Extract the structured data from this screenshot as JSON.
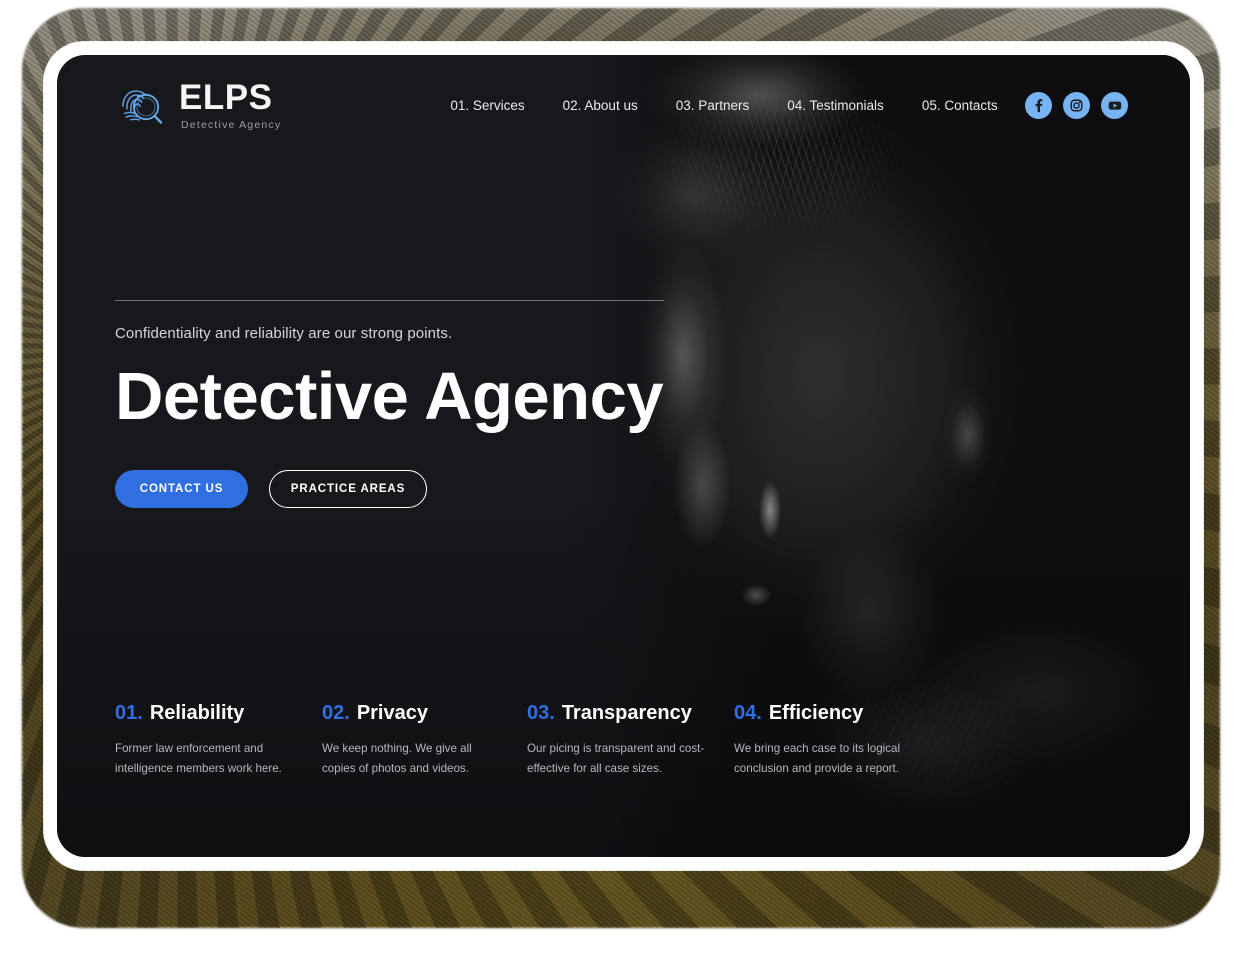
{
  "brand": {
    "name": "ELPS",
    "tagline": "Detective Agency",
    "icon": "fingerprint-magnifier-icon"
  },
  "nav": {
    "items": [
      {
        "label": "01. Services"
      },
      {
        "label": "02. About us"
      },
      {
        "label": "03. Partners"
      },
      {
        "label": "04. Testimonials"
      },
      {
        "label": "05. Contacts"
      }
    ]
  },
  "socials": [
    {
      "name": "facebook-icon",
      "label": "Facebook"
    },
    {
      "name": "instagram-icon",
      "label": "Instagram"
    },
    {
      "name": "youtube-icon",
      "label": "YouTube"
    }
  ],
  "hero": {
    "tagline": "Confidentiality and reliability are our strong points.",
    "title": "Detective Agency",
    "primary_button": "CONTACT US",
    "secondary_button": "PRACTICE AREAS"
  },
  "features": [
    {
      "num": "01.",
      "title": "Reliability",
      "desc": "Former law enforcement and intelligence members work here."
    },
    {
      "num": "02.",
      "title": "Privacy",
      "desc": "We keep nothing. We give all copies of photos and videos."
    },
    {
      "num": "03.",
      "title": "Transparency",
      "desc": "Our picing is transparent and cost-effective for all case sizes."
    },
    {
      "num": "04.",
      "title": "Efficiency",
      "desc": "We bring each case to its logical conclusion and provide a report."
    }
  ],
  "colors": {
    "accent_blue": "#2f6fe0",
    "social_blue": "#76b3f0",
    "page_bg": "#17181c",
    "text_primary": "#ffffff",
    "text_muted": "#b4b8bf"
  }
}
